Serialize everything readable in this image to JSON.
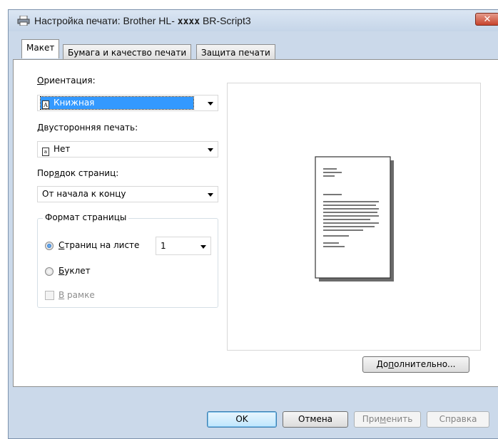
{
  "window": {
    "title_prefix": "Настройка печати: Brother HL-",
    "title_model": "xxxx",
    "title_suffix": "BR-Script3",
    "close_glyph": "✕"
  },
  "tabs": [
    {
      "label": "Макет",
      "active": true
    },
    {
      "label": "Бумага и качество печати",
      "active": false
    },
    {
      "label": "Защита печати",
      "active": false
    }
  ],
  "layout": {
    "orientation": {
      "label": "Ориентация:",
      "value": "Книжная",
      "icon": "A"
    },
    "duplex": {
      "label": "Двусторонняя печать:",
      "value": "Нет"
    },
    "page_order": {
      "label": "Порядок страниц:",
      "value": "От начала к концу"
    },
    "page_format": {
      "title": "Формат страницы",
      "pages_per_sheet": {
        "label": "Страниц на листе",
        "value": "1",
        "selected": true
      },
      "booklet": {
        "label": "Буклет",
        "selected": false
      },
      "border": {
        "label": "В рамке",
        "checked": false,
        "enabled": false
      }
    },
    "advanced_button": "Дополнительно..."
  },
  "footer": {
    "ok": "OK",
    "cancel": "Отмена",
    "apply": "Применить",
    "help": "Справка"
  }
}
